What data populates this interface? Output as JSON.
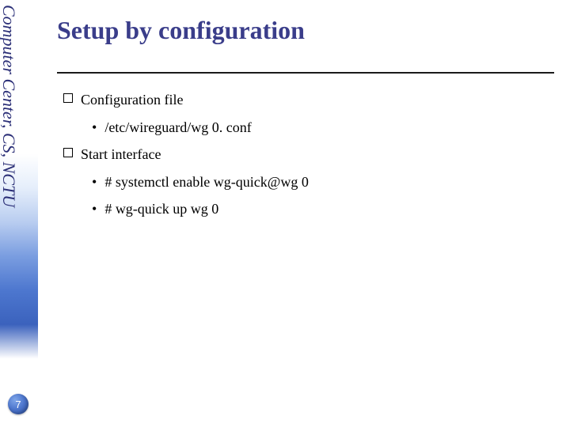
{
  "sidebar": {
    "org_text": "Computer Center, CS, NCTU"
  },
  "page": {
    "number": "7"
  },
  "slide": {
    "title": "Setup by configuration",
    "sections": [
      {
        "heading": "Configuration file",
        "items": [
          "/etc/wireguard/wg 0. conf"
        ]
      },
      {
        "heading": "Start interface",
        "items": [
          "# systemctl enable wg-quick@wg 0",
          "# wg-quick up wg 0"
        ]
      }
    ]
  }
}
